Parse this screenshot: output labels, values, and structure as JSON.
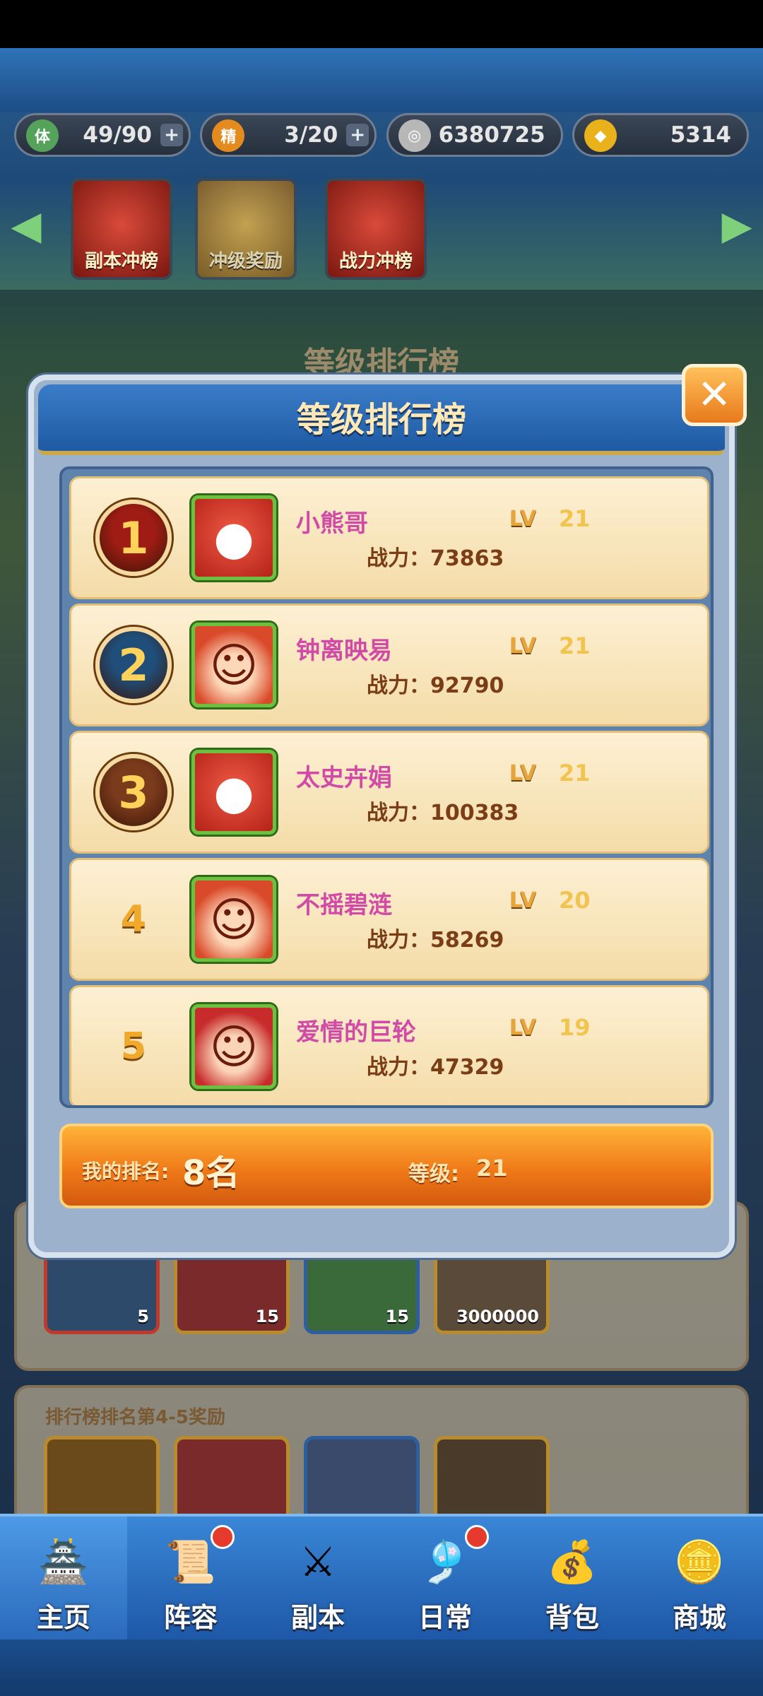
{
  "resources": [
    {
      "icon": "stamina-icon",
      "glyph": "体",
      "color": "#55a25a",
      "value": "49/90",
      "plus": true
    },
    {
      "icon": "spirit-flame-icon",
      "glyph": "精",
      "color": "#e38b1e",
      "value": "3/20",
      "plus": true
    },
    {
      "icon": "coin-icon",
      "glyph": "◎",
      "color": "#b7b7b7",
      "value": "6380725",
      "plus": false
    },
    {
      "icon": "gold-ingot-icon",
      "glyph": "◆",
      "color": "#e9b21a",
      "value": "5314",
      "plus": false
    }
  ],
  "events": [
    {
      "label": "副本冲榜"
    },
    {
      "label": "冲级奖励"
    },
    {
      "label": "战力冲榜"
    }
  ],
  "background_title": "等级排行榜",
  "modal": {
    "title": "等级排行榜",
    "close": "✕"
  },
  "ranking": [
    {
      "rank": "1",
      "name": "小熊哥",
      "lv_label": "LV",
      "level": "21",
      "power": "战力：73863",
      "avatar": "monster",
      "medal_color": "#9e1c14"
    },
    {
      "rank": "2",
      "name": "钟离映易",
      "lv_label": "LV",
      "level": "21",
      "power": "战力：92790",
      "avatar": "hero",
      "medal_color": "#1f4e7a"
    },
    {
      "rank": "3",
      "name": "太史卉娟",
      "lv_label": "LV",
      "level": "21",
      "power": "战力：100383",
      "avatar": "monster",
      "medal_color": "#7a3a1c"
    },
    {
      "rank": "4",
      "name": "不摇碧涟",
      "lv_label": "LV",
      "level": "20",
      "power": "战力：58269",
      "avatar": "hero",
      "medal_color": ""
    },
    {
      "rank": "5",
      "name": "爱情的巨轮",
      "lv_label": "LV",
      "level": "19",
      "power": "战力：47329",
      "avatar": "girl",
      "medal_color": ""
    }
  ],
  "my_rank": {
    "label": "我的排名:",
    "value": "8名",
    "level_label": "等级:",
    "level_value": "21"
  },
  "rewards_row1": [
    "5",
    "15",
    "15",
    "3000000"
  ],
  "reward_section_title": "排行榜排名第4-5奖励",
  "nav": [
    {
      "label": "主页",
      "icon": "home-palace-icon",
      "glyph": "🏯",
      "badge": false,
      "active": true
    },
    {
      "label": "阵容",
      "icon": "lineup-scroll-icon",
      "glyph": "📜",
      "badge": true,
      "active": false
    },
    {
      "label": "副本",
      "icon": "dungeon-swords-icon",
      "glyph": "⚔",
      "badge": false,
      "active": false
    },
    {
      "label": "日常",
      "icon": "daily-scroll-icon",
      "glyph": "🎐",
      "badge": true,
      "active": false
    },
    {
      "label": "背包",
      "icon": "bag-icon",
      "glyph": "💰",
      "badge": false,
      "active": false
    },
    {
      "label": "商城",
      "icon": "shop-coins-icon",
      "glyph": "🪙",
      "badge": false,
      "active": false
    }
  ]
}
